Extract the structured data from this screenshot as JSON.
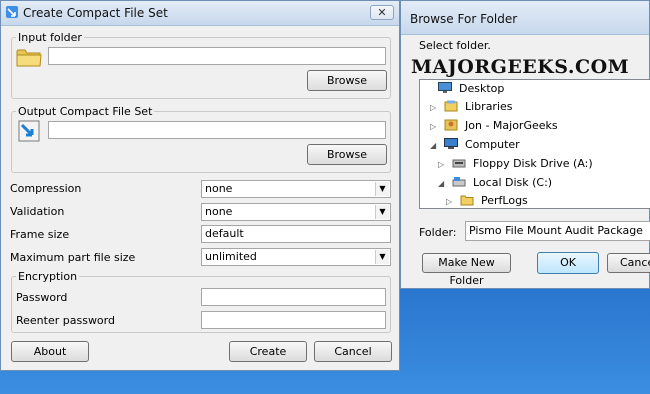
{
  "window1": {
    "title": "Create Compact File Set",
    "close_glyph": "✕",
    "input_group": {
      "legend": "Input folder",
      "value": "",
      "browse_label": "Browse"
    },
    "output_group": {
      "legend": "Output Compact File Set",
      "value": "",
      "browse_label": "Browse"
    },
    "compression": {
      "label": "Compression",
      "value": "none"
    },
    "validation": {
      "label": "Validation",
      "value": "none"
    },
    "frame_size": {
      "label": "Frame size",
      "value": "default"
    },
    "max_part": {
      "label": "Maximum part file size",
      "value": "unlimited"
    },
    "encryption": {
      "legend": "Encryption",
      "password_label": "Password",
      "reenter_label": "Reenter password"
    },
    "buttons": {
      "about": "About",
      "create": "Create",
      "cancel": "Cancel"
    }
  },
  "window2": {
    "title": "Browse For Folder",
    "prompt": "Select folder.",
    "watermark": "MAJORGEEKS.COM",
    "tree": [
      {
        "label": "Desktop",
        "icon": "desktop-icon"
      },
      {
        "label": "Libraries",
        "icon": "libraries-icon"
      },
      {
        "label": "Jon - MajorGeeks",
        "icon": "user-icon"
      },
      {
        "label": "Computer",
        "icon": "computer-icon"
      },
      {
        "label": "Floppy Disk Drive (A:)",
        "icon": "floppy-icon"
      },
      {
        "label": "Local Disk (C:)",
        "icon": "disk-icon"
      },
      {
        "label": "PerfLogs",
        "icon": "folder-icon"
      }
    ],
    "folder_label": "Folder:",
    "folder_value": "Pismo File Mount Audit Package",
    "buttons": {
      "make_new": "Make New Folder",
      "ok": "OK",
      "cancel": "Cance"
    }
  }
}
